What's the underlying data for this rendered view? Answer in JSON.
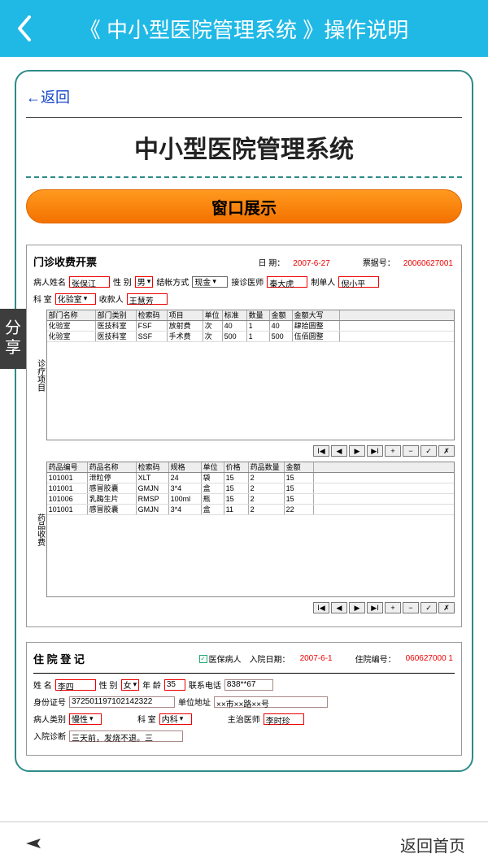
{
  "colors": {
    "header_bg": "#20b9e6",
    "accent": "#2e8b88",
    "orange": "#f37100"
  },
  "topbar": {
    "title": "《 中小型医院管理系统 》操作说明"
  },
  "content": {
    "back_link": "←返回",
    "system_title": "中小型医院管理系统",
    "section_button": "窗口展示"
  },
  "share_tab": "分\n享",
  "panel1": {
    "title": "门诊收费开票",
    "date_label": "日    期：",
    "date_value": "2007-6-27",
    "ticket_label": "票据号：",
    "ticket_value": "20060627001",
    "patient_name_label": "病人姓名",
    "patient_name": "张保江",
    "gender_label": "性 别",
    "gender": "男",
    "pay_method_label": "结帐方式",
    "pay_method": "现金",
    "doctor_label": "接诊医师",
    "doctor": "秦大虎",
    "creator_label": "制单人",
    "creator": "倪小平",
    "dept_label": "科    室",
    "dept": "化验室",
    "cashier_label": "收款人",
    "cashier": "王慧芳",
    "section_items_label": "诊疗项目",
    "section_medicine_label": "药品收费",
    "items_headers": [
      "部门名称",
      "部门类别",
      "检索码",
      "项目",
      "单位",
      "标准",
      "数量",
      "金额",
      "金额大写"
    ],
    "items_rows": [
      [
        "化验室",
        "医技科室",
        "FSF",
        "放射费",
        "次",
        "40",
        "1",
        "40",
        "肆拾圆整"
      ],
      [
        "化验室",
        "医技科室",
        "SSF",
        "手术费",
        "次",
        "500",
        "1",
        "500",
        "伍佰圆整"
      ]
    ],
    "med_headers": [
      "药品编号",
      "药品名称",
      "检索码",
      "规格",
      "单位",
      "价格",
      "药品数量",
      "金额"
    ],
    "med_rows": [
      [
        "101001",
        "泄粒停",
        "XLT",
        "24",
        "袋",
        "15",
        "2",
        "15"
      ],
      [
        "101001",
        "感冒胶囊",
        "GMJN",
        "3*4",
        "盒",
        "15",
        "2",
        "15"
      ],
      [
        "101006",
        "乳酶生片",
        "RMSP",
        "100ml",
        "瓶",
        "15",
        "2",
        "15"
      ],
      [
        "101001",
        "感冒胶囊",
        "GMJN",
        "3*4",
        "盒",
        "11",
        "2",
        "22"
      ]
    ],
    "toolbar_icons": [
      "I◀",
      "◀",
      "▶",
      "▶I",
      "+",
      "−",
      "✓",
      "✗"
    ]
  },
  "panel2": {
    "title": "住    院    登    记",
    "insurance_label": "医保病人",
    "enter_date_label": "入院日期：",
    "enter_date": "2007-6-1",
    "admission_no_label": "住院编号：",
    "admission_no": "060627000 1",
    "name_label": "姓    名",
    "name": "李四",
    "gender_label": "性    别",
    "gender": "女",
    "age_label": "年 龄",
    "age": "35",
    "phone_label": "联系电话",
    "phone": "838**67",
    "id_label": "身份证号",
    "id": "372501197102142322",
    "addr_label": "单位地址",
    "addr": "××市××路××号",
    "patient_type_label": "病人类别",
    "patient_type": "慢性",
    "dept_label": "科    室",
    "dept": "内科",
    "attending_label": "主治医师",
    "attending": "李时珍",
    "diag_label": "入院诊断",
    "diag": "三天前，发烧不退。三"
  },
  "bottom": {
    "home_label": "返回首页"
  }
}
